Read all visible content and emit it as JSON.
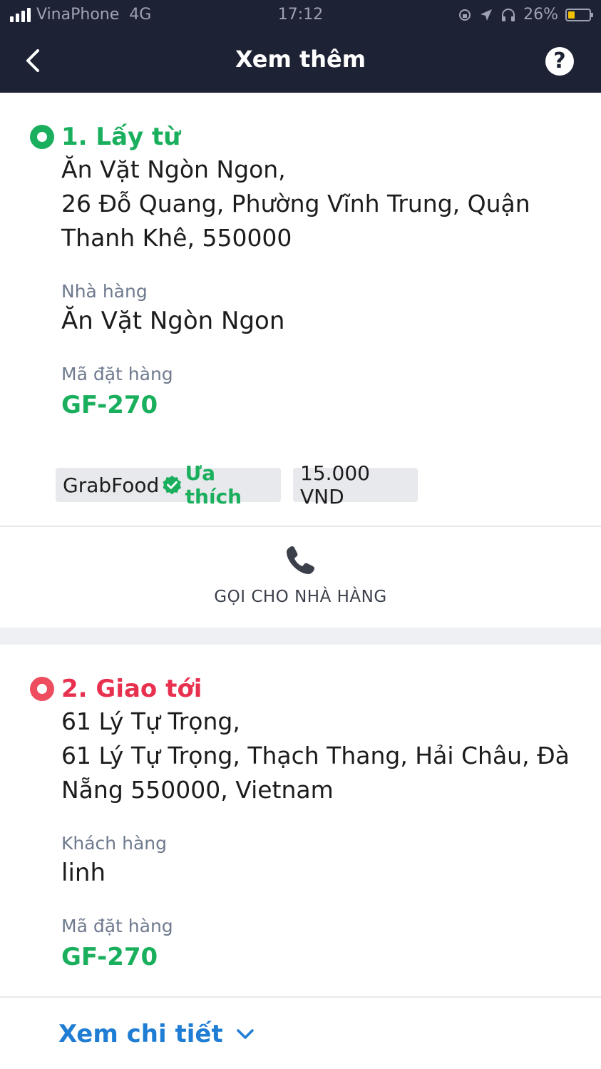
{
  "status_bar": {
    "carrier": "VinaPhone",
    "network": "4G",
    "time": "17:12",
    "battery": "26%"
  },
  "header": {
    "title": "Xem thêm",
    "help_label": "?"
  },
  "pickup": {
    "title": "1. Lấy từ",
    "address_line1": "Ăn Vặt Ngòn Ngon,",
    "address_line2": "26 Đỗ Quang, Phường Vĩnh Trung, Quận",
    "address_line3": "Thanh Khê, 550000",
    "restaurant_label": "Nhà hàng",
    "restaurant_name": "Ăn Vặt Ngòn Ngon",
    "order_label": "Mã đặt hàng",
    "order_code": "GF-270",
    "service_tag": "GrabFood",
    "favorite_tag": "Ưa thích",
    "price_tag": "15.000 VND",
    "call_label": "GỌI CHO NHÀ HÀNG"
  },
  "dropoff": {
    "title": "2. Giao tới",
    "address_line1": "61 Lý Tự Trọng,",
    "address_line2": "61 Lý Tự Trọng, Thạch Thang, Hải Châu, Đà",
    "address_line3": "Nẵng 550000, Vietnam",
    "customer_label": "Khách hàng",
    "customer_name": "linh",
    "order_label": "Mã đặt hàng",
    "order_code": "GF-270",
    "details_label": "Xem chi tiết"
  },
  "colors": {
    "header_bg": "#1e2235",
    "green": "#1aaf5d",
    "red": "#e8304f",
    "link_blue": "#1f7ed4"
  },
  "icons": [
    "signal-icon",
    "location-arrow-icon",
    "headphones-icon",
    "battery-icon",
    "back-chevron-icon",
    "help-icon",
    "verified-badge-icon",
    "phone-icon",
    "chevron-down-icon"
  ]
}
